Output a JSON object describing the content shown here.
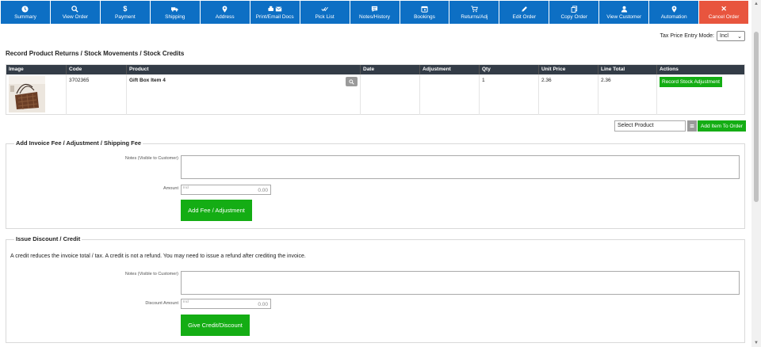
{
  "toolbar": {
    "buttons": [
      {
        "label": "Summary",
        "icon": "clock-icon"
      },
      {
        "label": "View Order",
        "icon": "search-icon"
      },
      {
        "label": "Payment",
        "icon": "dollar-icon"
      },
      {
        "label": "Shipping",
        "icon": "truck-icon"
      },
      {
        "label": "Address",
        "icon": "map-marker-icon"
      },
      {
        "label": "Print/Email Docs",
        "icon": "print-envelope-icon"
      },
      {
        "label": "Pick List",
        "icon": "checkmark-icon"
      },
      {
        "label": "Notes/History",
        "icon": "comment-icon"
      },
      {
        "label": "Bookings",
        "icon": "calendar-icon"
      },
      {
        "label": "Returns/Adj",
        "icon": "cart-icon"
      },
      {
        "label": "Edit Order",
        "icon": "pencil-icon"
      },
      {
        "label": "Copy Order",
        "icon": "copy-icon"
      },
      {
        "label": "View Customer",
        "icon": "user-icon"
      },
      {
        "label": "Automation",
        "icon": "map-marker-icon"
      },
      {
        "label": "Cancel Order",
        "icon": "close-icon"
      }
    ],
    "cancel_color": "#e8553e",
    "button_color": "#0d6fc4"
  },
  "tax_mode": {
    "label": "Tax Price Entry Mode:",
    "value": "Incl"
  },
  "section_title": "Record Product Returns / Stock Movements / Stock Credits",
  "table": {
    "headers": [
      "Image",
      "Code",
      "Product",
      "Date",
      "Adjustment",
      "Qty",
      "Unit Price",
      "Line Total",
      "Actions"
    ],
    "rows": [
      {
        "code": "3702365",
        "product": "Gift Box Item 4",
        "date": "",
        "adjustment": "",
        "qty": "1",
        "unit_price": "2.36",
        "line_total": "2.36",
        "action": "Record Stock Adjustment"
      }
    ]
  },
  "add_item": {
    "select_placeholder": "Select Product",
    "button": "Add Item To Order"
  },
  "fee_section": {
    "legend": "Add Invoice Fee / Adjustment / Shipping Fee",
    "notes_label": "Notes (Visible to Customer)",
    "amount_label": "Amount",
    "amount_placeholder": "Incl",
    "amount_value": "0.00",
    "button": "Add Fee / Adjustment"
  },
  "credit_section": {
    "legend": "Issue Discount / Credit",
    "note": "A credit reduces the invoice total / tax. A credit is not a refund. You may need to issue a refund after crediting the invoice.",
    "notes_label": "Notes (Visible to Customer)",
    "amount_label": "Discount Amount",
    "amount_placeholder": "Incl",
    "amount_value": "0.00",
    "button": "Give Credit/Discount"
  },
  "accent_green": "#14ad14",
  "table_header_color": "#333c47"
}
